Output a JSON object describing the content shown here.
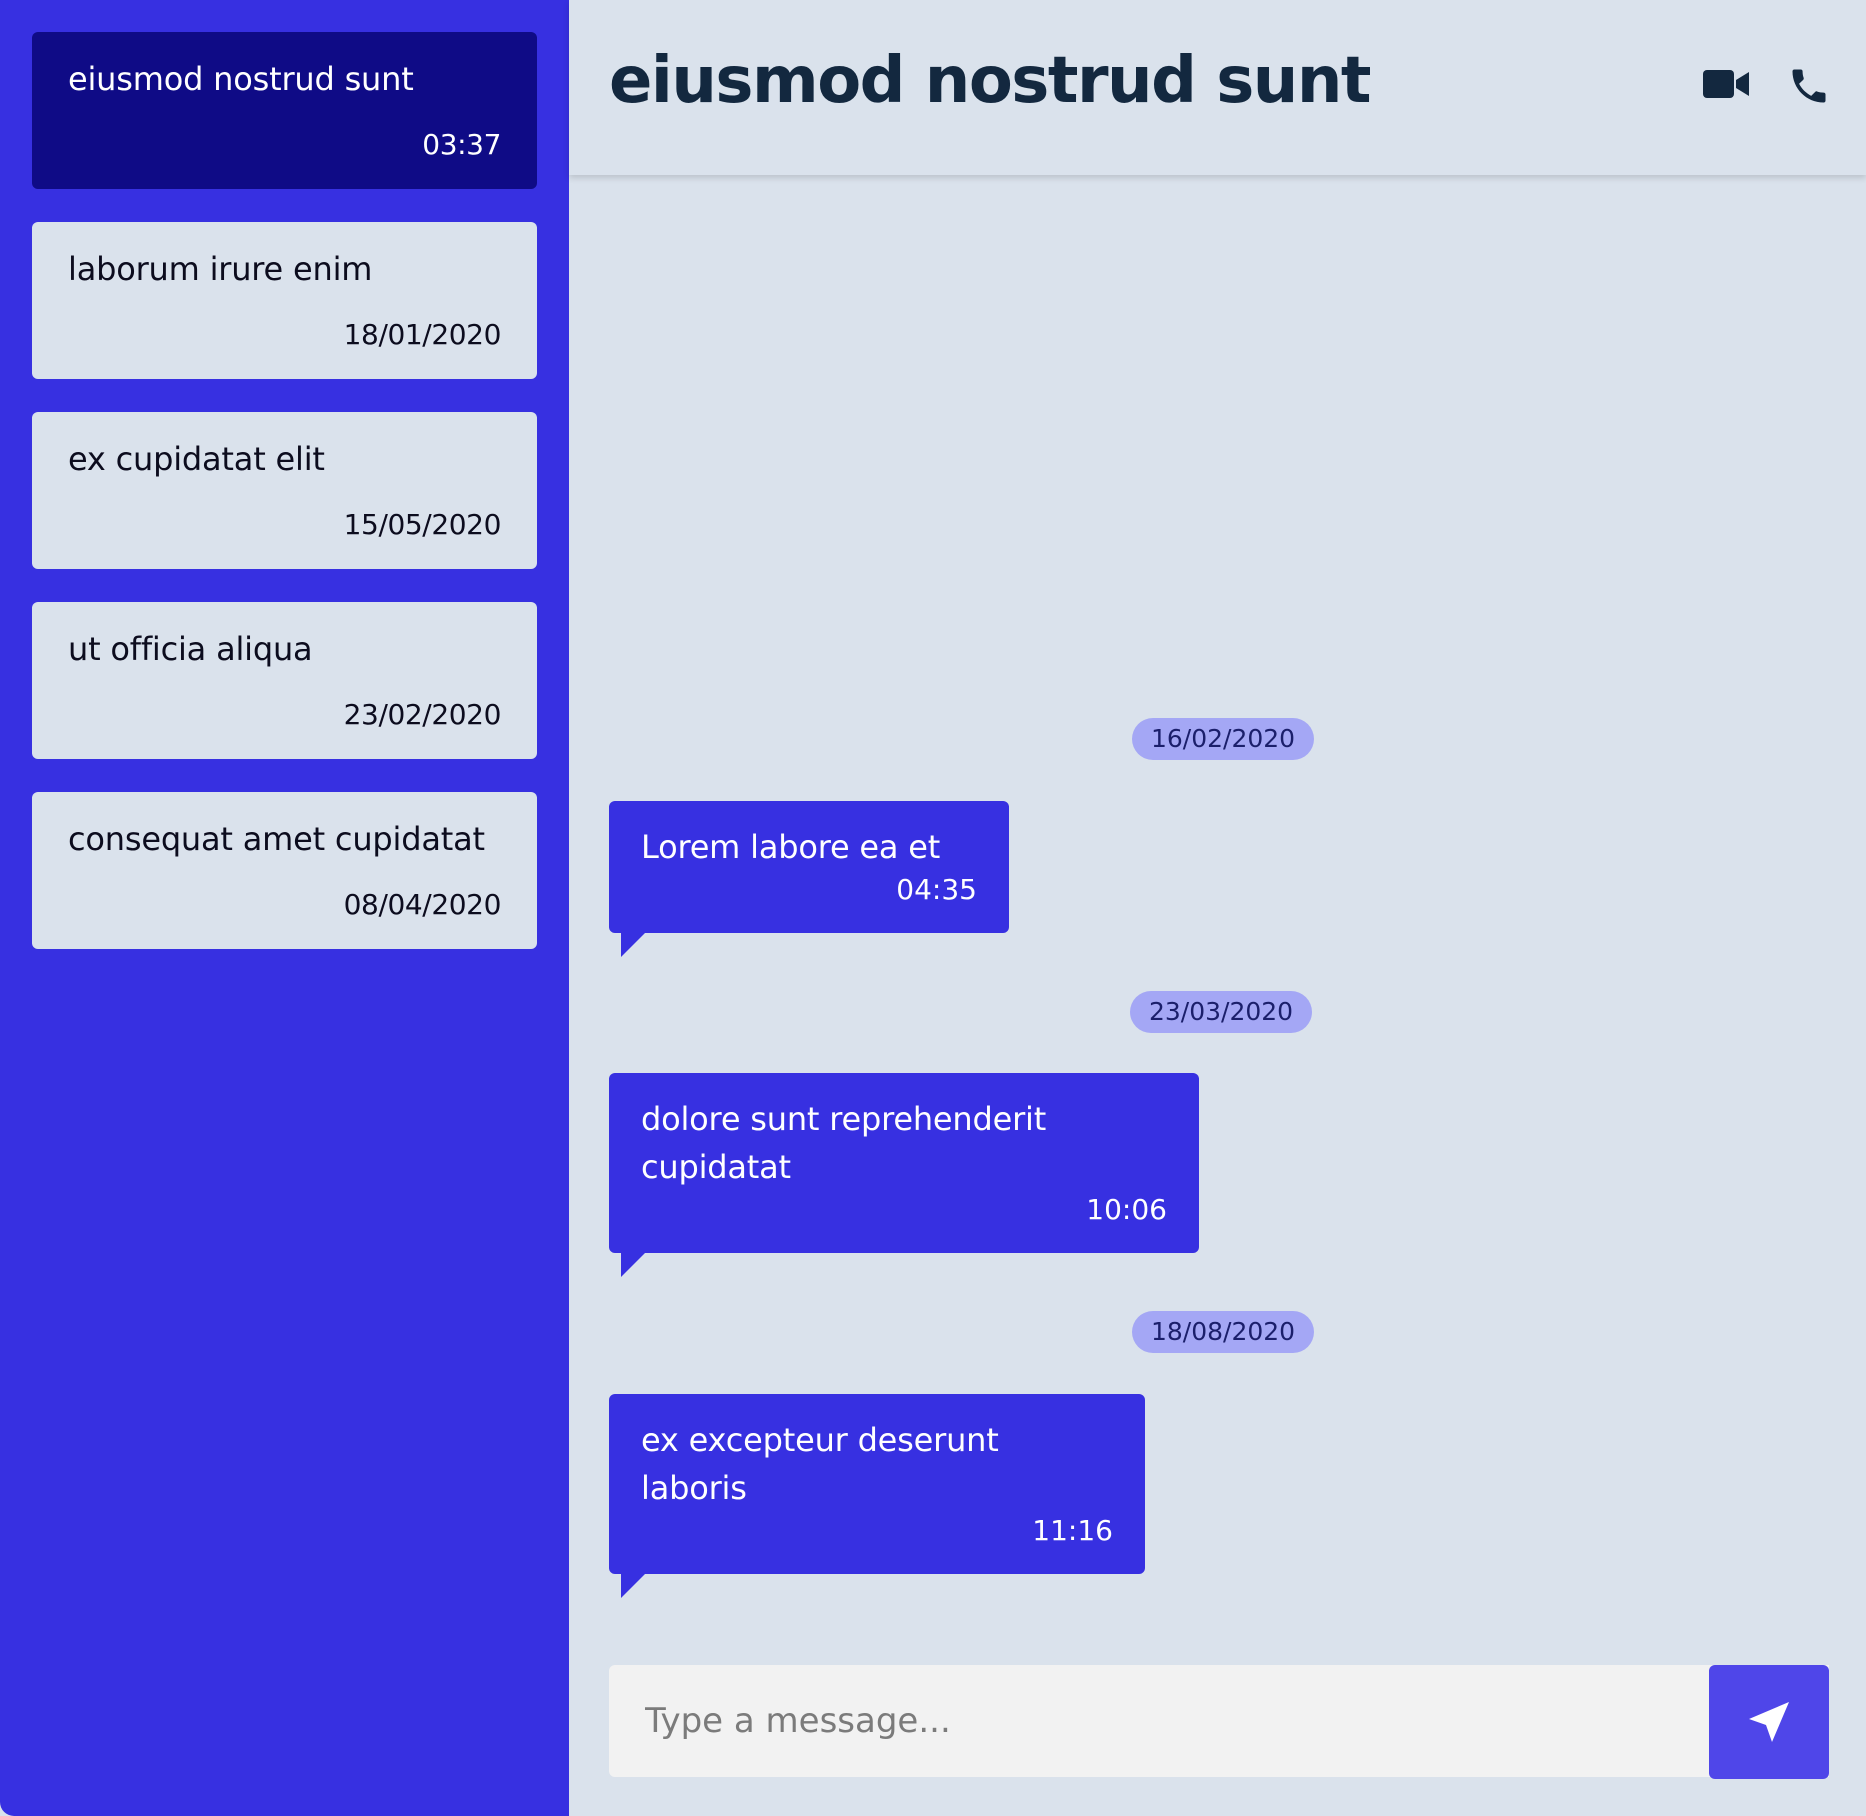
{
  "sidebar": {
    "conversations": [
      {
        "name": "eiusmod nostrud sunt",
        "time": "03:37",
        "active": true
      },
      {
        "name": "laborum irure enim",
        "time": "18/01/2020"
      },
      {
        "name": "ex cupidatat elit",
        "time": "15/05/2020"
      },
      {
        "name": "ut officia aliqua",
        "time": "23/02/2020"
      },
      {
        "name": "consequat amet cupidatat",
        "time": "08/04/2020"
      }
    ]
  },
  "header": {
    "title": "eiusmod nostrud sunt",
    "icons": [
      "video-camera-icon",
      "phone-icon"
    ]
  },
  "messages": {
    "dates": [
      "16/02/2020",
      "23/03/2020",
      "18/08/2020"
    ],
    "items": [
      {
        "text": "Lorem labore ea et",
        "time": "04:35"
      },
      {
        "text": "dolore sunt reprehenderit cupidatat",
        "time": "10:06"
      },
      {
        "text": "ex excepteur deserunt laboris",
        "time": "11:16"
      }
    ]
  },
  "composer": {
    "placeholder": "Type a message...",
    "send_icon": "send-icon"
  },
  "colors": {
    "sidebar_bg": "#3730e1",
    "active_conv": "#0f0b86",
    "bubble": "#3730e1",
    "date_chip": "#a4a7f5",
    "send_button": "#4f46e9",
    "background": "#dae2ec"
  }
}
